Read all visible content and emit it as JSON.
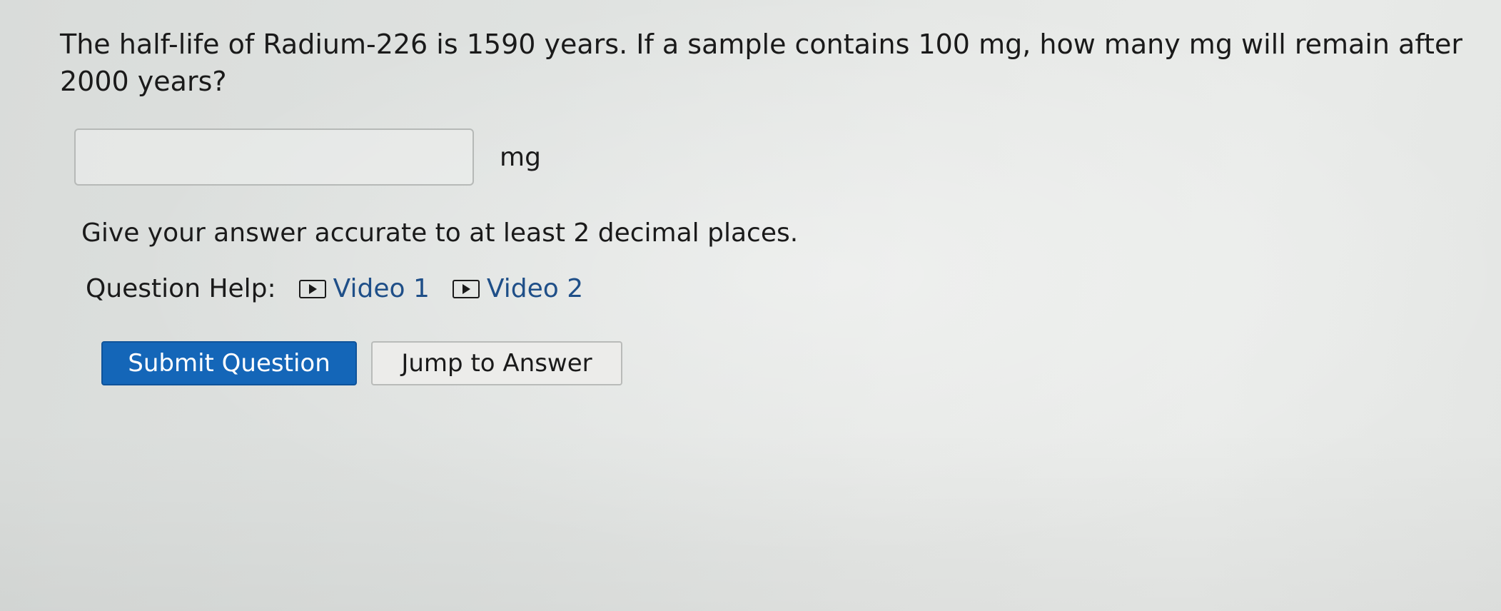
{
  "question": {
    "text": "The half-life of Radium-226 is 1590 years. If a sample contains 100 mg, how many mg will remain after 2000 years?"
  },
  "answer": {
    "value": "",
    "placeholder": "",
    "unit": "mg"
  },
  "instruction": "Give your answer accurate to at least 2 decimal places.",
  "help": {
    "label": "Question Help:",
    "videos": [
      {
        "label": "Video 1",
        "icon": "play-video-icon"
      },
      {
        "label": "Video 2",
        "icon": "play-video-icon"
      }
    ]
  },
  "buttons": {
    "submit_label": "Submit Question",
    "jump_label": "Jump to Answer"
  },
  "colors": {
    "primary_button": "#1466b8",
    "link": "#1f4f88"
  }
}
